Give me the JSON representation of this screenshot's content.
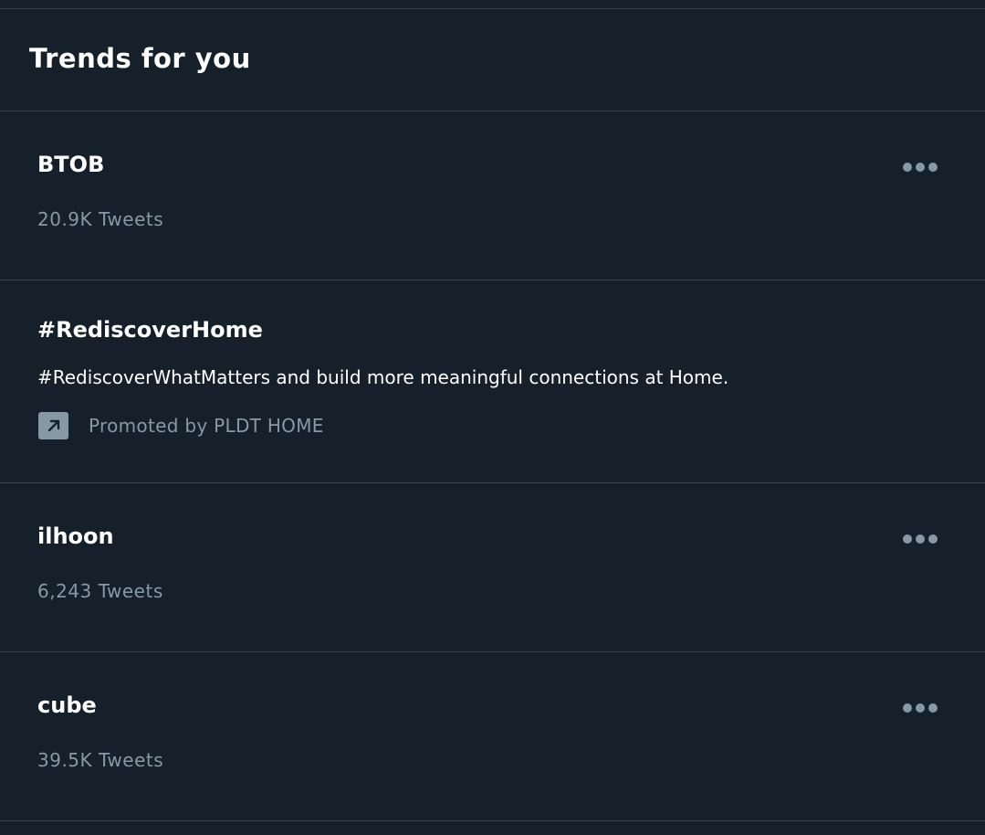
{
  "header": {
    "title": "Trends for you"
  },
  "trends": [
    {
      "name": "BTOB",
      "count": "20.9K Tweets"
    },
    {
      "name": "#RediscoverHome",
      "description": "#RediscoverWhatMatters and build more meaningful connections at Home.",
      "promoted_label": "Promoted by PLDT HOME"
    },
    {
      "name": "ilhoon",
      "count": "6,243 Tweets"
    },
    {
      "name": "cube",
      "count": "39.5K Tweets"
    }
  ],
  "icons": {
    "more": "more-horizontal-icon",
    "promoted": "promoted-arrow-icon"
  },
  "colors": {
    "background": "#15202b",
    "divider": "#38444d",
    "secondary_text": "#8899a6",
    "primary_text": "#ffffff"
  }
}
